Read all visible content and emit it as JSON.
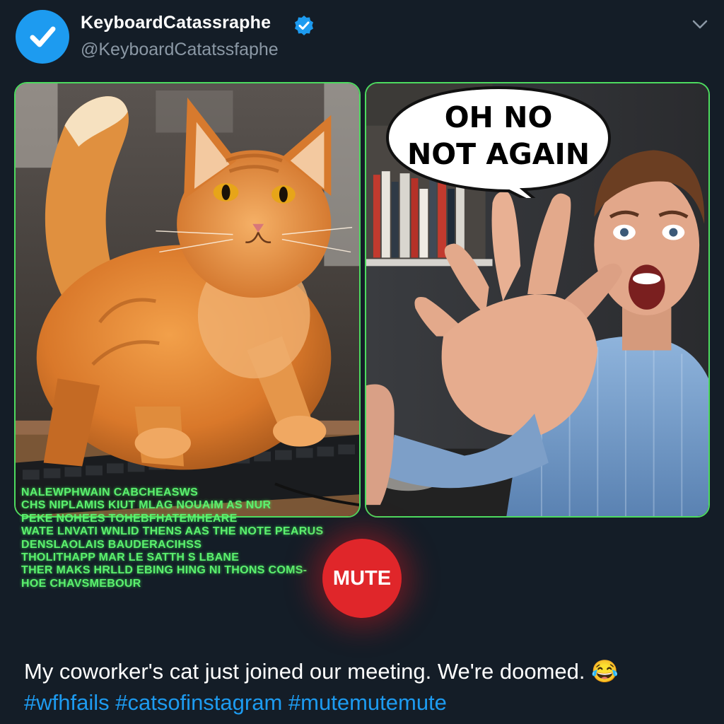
{
  "post": {
    "display_name": "KeyboardCatassraphe",
    "handle": "@KeyboardCatatssfaphe",
    "verified": true,
    "avatar_icon": "checkmark-avatar-icon",
    "more_icon": "chevron-down-icon"
  },
  "media": {
    "left_panel": {
      "subject": "cat-on-keyboard-image"
    },
    "right_panel": {
      "subject": "shocked-man-image",
      "speech_bubble": {
        "line1": "OH NO",
        "line2": "NOT AGAIN"
      }
    },
    "keyboard_gibberish": [
      "NALEWPHWAIN CABCHEASWS",
      "CHS NIPLAMIS KIUT MLAG NOUAIM AS NUR",
      "PEKE NOHEES TOHEBFHATEMHEARE",
      "WATE LNVATI WNLID THENS AAS THE NOTE PEARUS",
      "DENSLAOLAIS BAUDERACIHSS",
      "THOLITHAPP MAR LE SATTH S LBANE",
      "THER MAKS HRLLD EBING HING NI THONS COMS-",
      "HOE CHAVSMEBOUR"
    ],
    "mute_button_label": "MUTE"
  },
  "caption": {
    "text": "My coworker's cat just joined our meeting. We're doomed. 😂",
    "hashtags": [
      "#wfhfails",
      "#catsofinstagram",
      "#mutemutemute"
    ]
  },
  "colors": {
    "background": "#141d27",
    "accent_blue": "#1d9bf0",
    "panel_border": "#4ddb5f",
    "mute_red": "#e0262a",
    "gibberish_green": "#5cf06e"
  }
}
